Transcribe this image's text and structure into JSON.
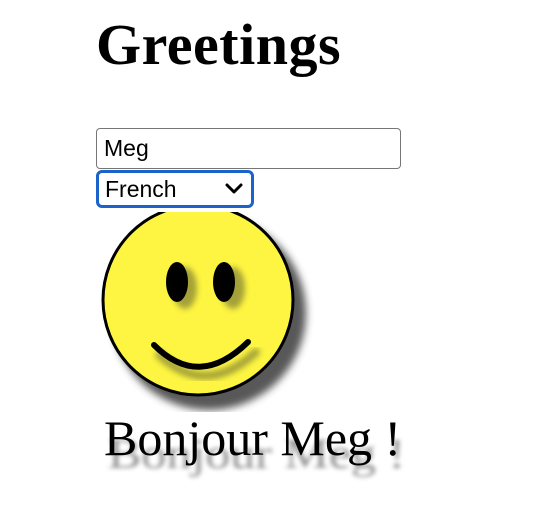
{
  "page": {
    "title": "Greetings"
  },
  "form": {
    "name_value": "Meg",
    "language_selected": "French"
  },
  "image": {
    "icon": "smiley-face-icon",
    "face_color": "#fdf542",
    "greeting": "Bonjour Meg !"
  },
  "colors": {
    "focus_ring": "#1c63c9"
  }
}
